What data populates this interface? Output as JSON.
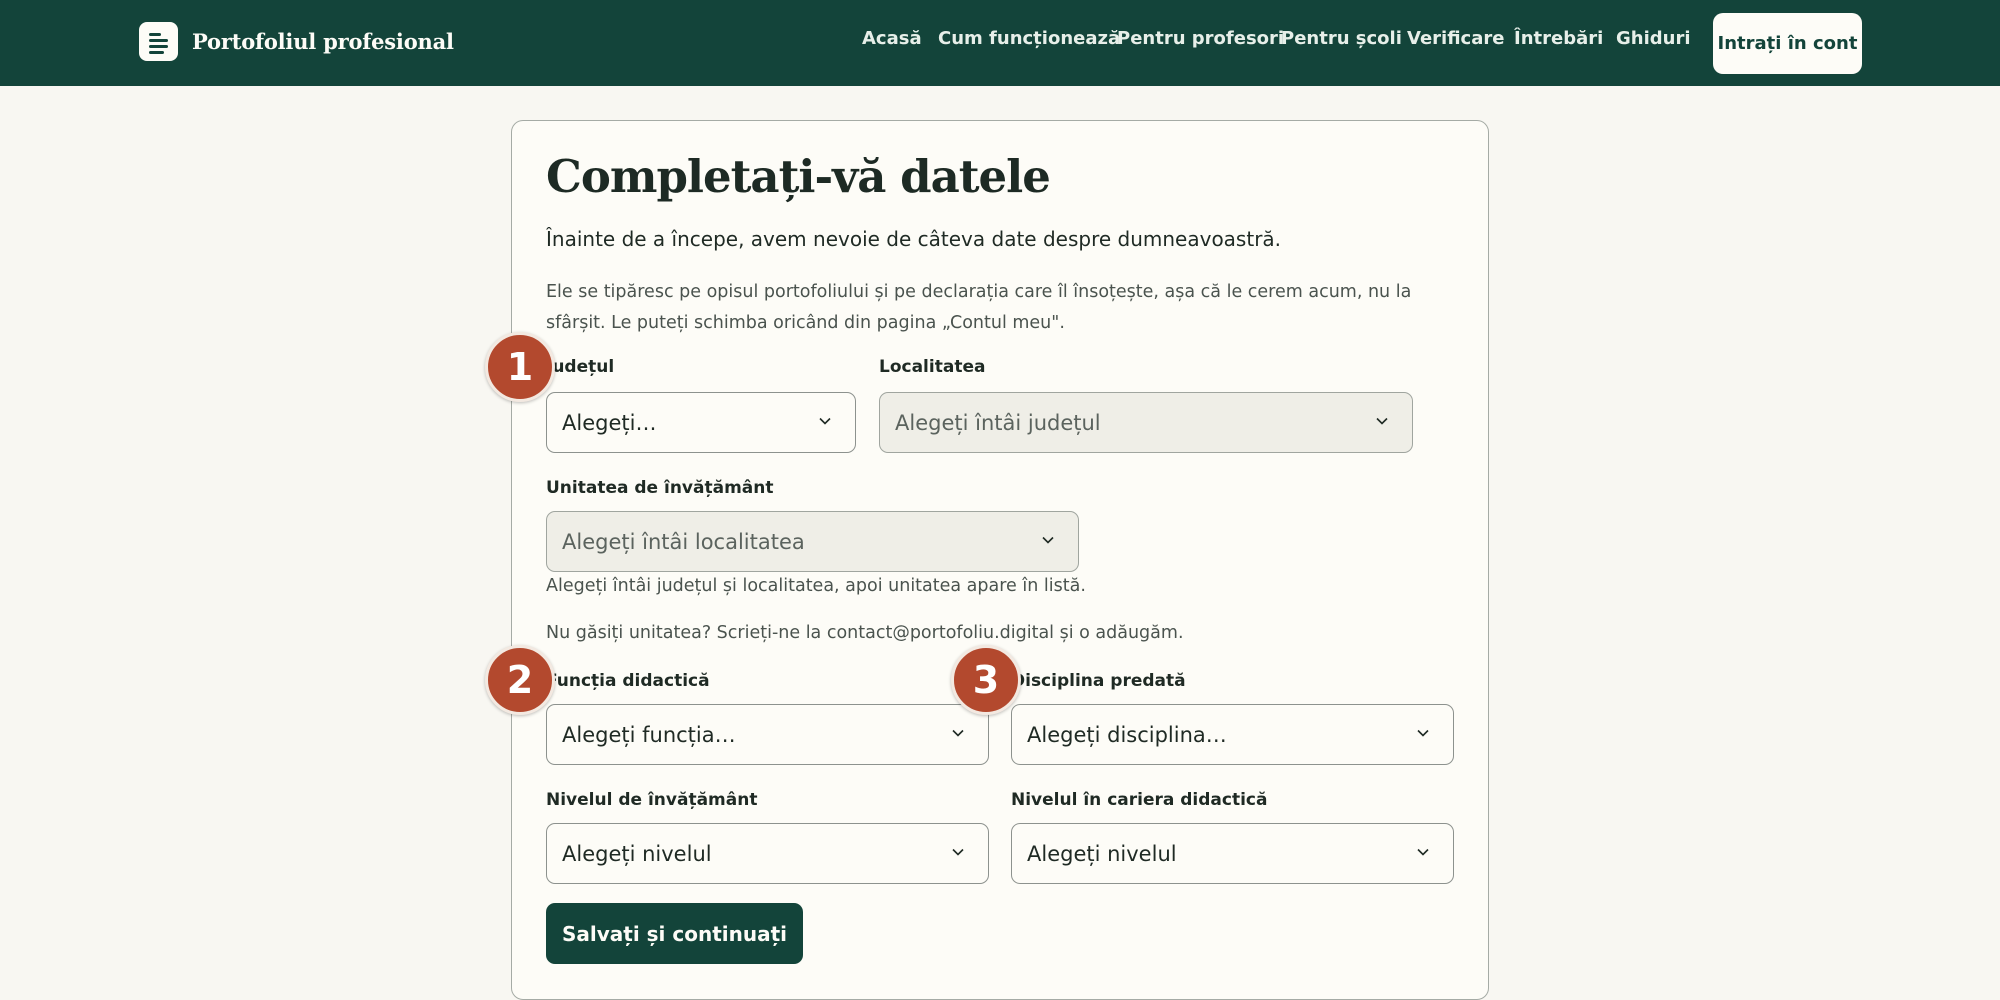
{
  "header": {
    "brand": "Portofoliul profesional",
    "nav": [
      "Acasă",
      "Cum funcționează",
      "Pentru profesori",
      "Pentru școli",
      "Verificare",
      "Întrebări",
      "Ghiduri"
    ],
    "login": "Intrați în cont"
  },
  "form": {
    "title": "Completați-vă datele",
    "lead": "Înainte de a începe, avem nevoie de câteva date despre dumneavoastră.",
    "description": "Ele se tipăresc pe opisul portofoliului și pe declarația care îl însoțește, așa că le cerem acum, nu la sfârșit. Le puteți schimba oricând din pagina „Contul meu\".",
    "judet": {
      "label": "Județul",
      "value": "Alegeți…"
    },
    "localitate": {
      "label": "Localitatea",
      "value": "Alegeți întâi județul"
    },
    "unitate": {
      "label": "Unitatea de învățământ",
      "value": "Alegeți întâi localitatea",
      "helper": "Alegeți întâi județul și localitatea, apoi unitatea apare în listă.",
      "missing": "Nu găsiți unitatea? Scrieți-ne la contact@portofoliu.digital și o adăugăm."
    },
    "functie": {
      "label": "Funcția didactică",
      "value": "Alegeți funcția…"
    },
    "disciplina": {
      "label": "Disciplina predată",
      "value": "Alegeți disciplina…"
    },
    "nivel_invatamant": {
      "label": "Nivelul de învățământ",
      "value": "Alegeți nivelul"
    },
    "nivel_cariera": {
      "label": "Nivelul în cariera didactică",
      "value": "Alegeți nivelul"
    },
    "submit": "Salvați și continuați"
  },
  "annotations": [
    "1",
    "2",
    "3"
  ],
  "colors": {
    "header": "#13443a",
    "badge": "#b3492e",
    "background": "#f8f7f2"
  }
}
